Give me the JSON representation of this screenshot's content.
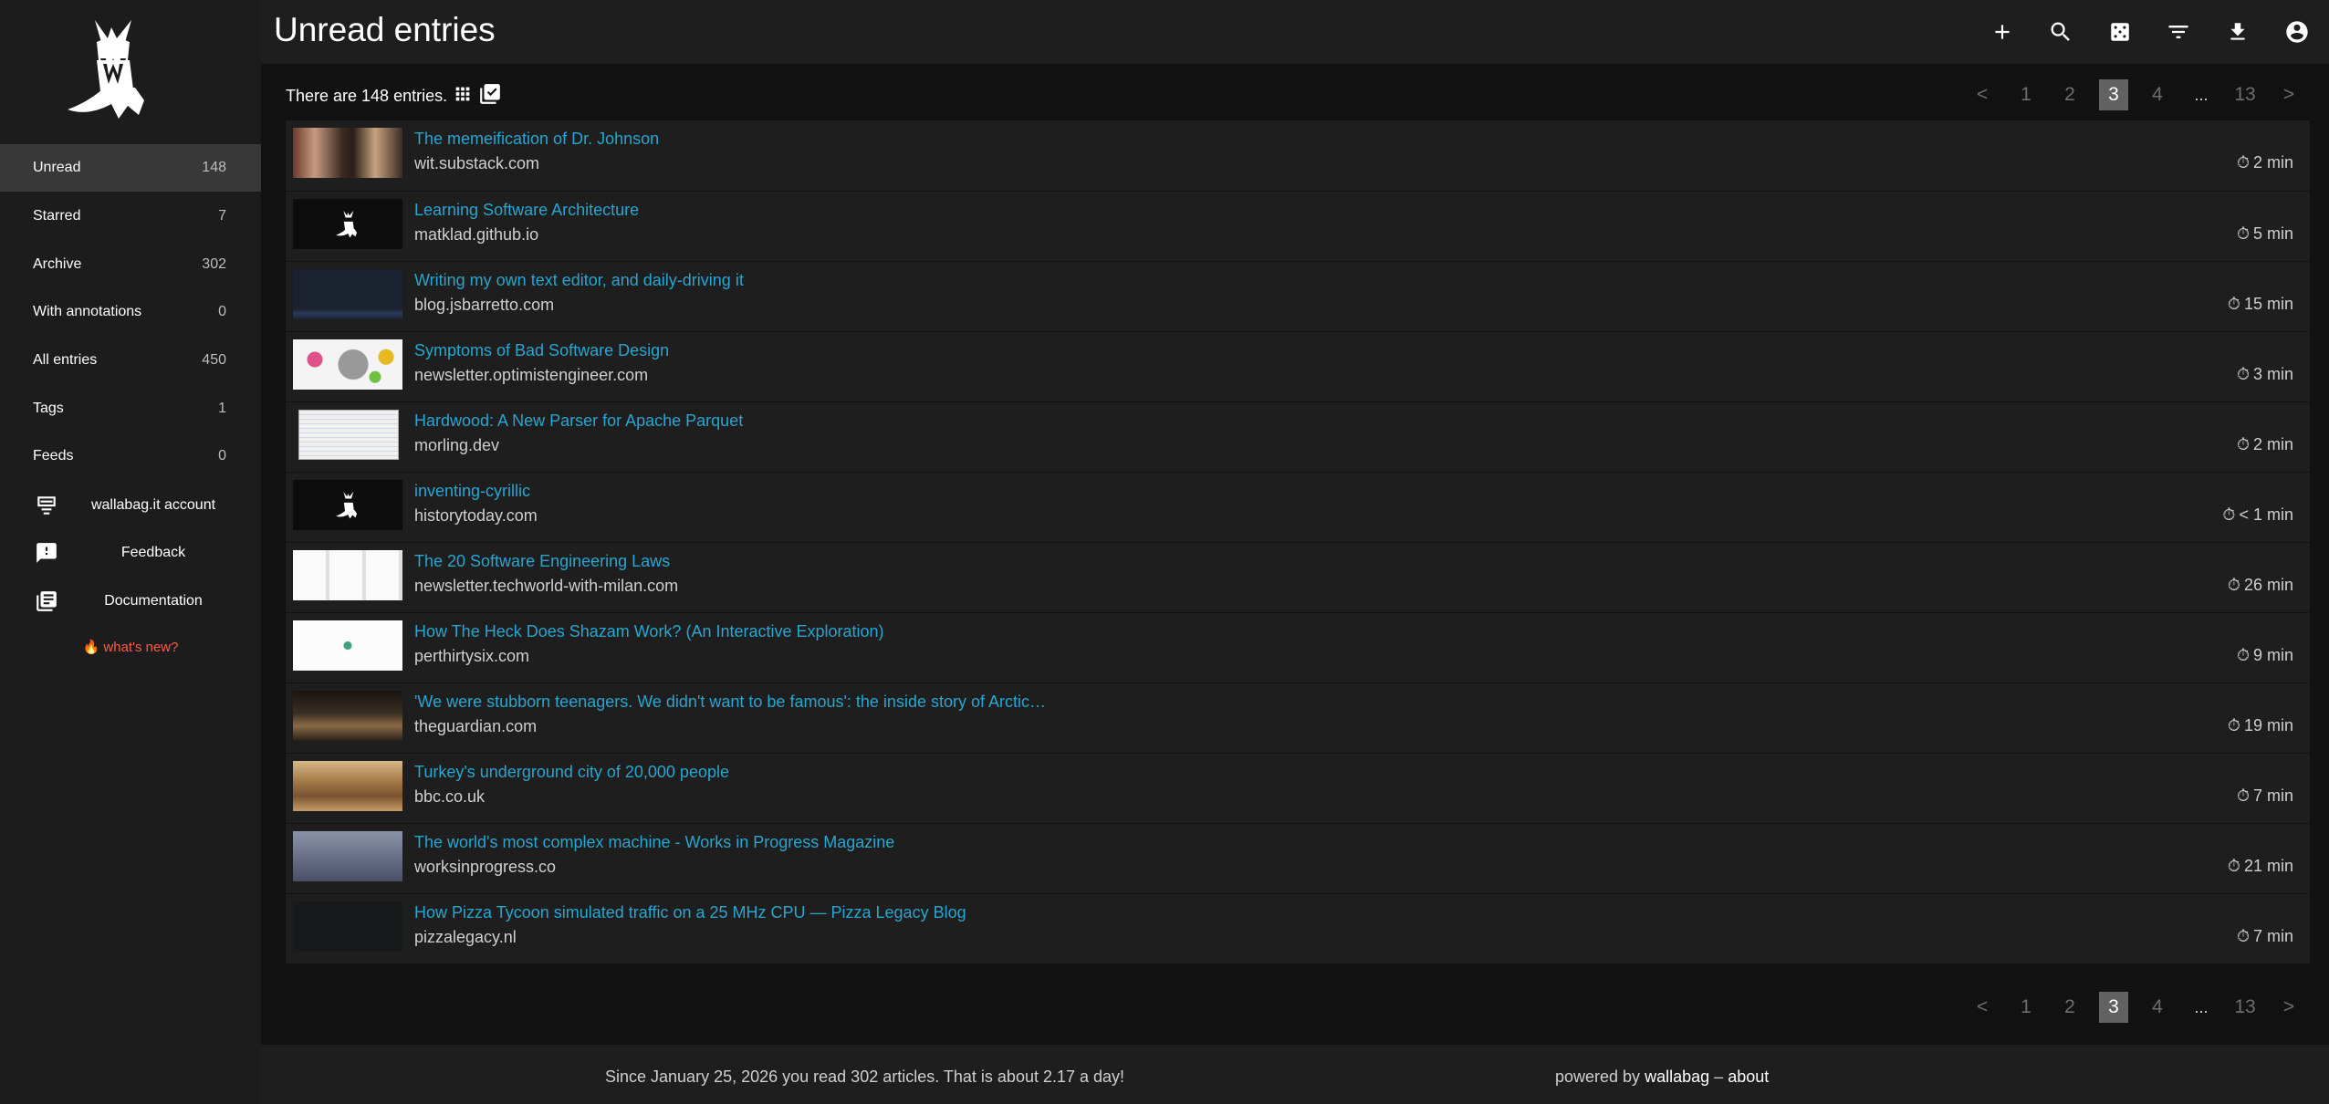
{
  "header": {
    "title": "Unread entries",
    "icons": [
      "add-icon",
      "search-icon",
      "random-icon",
      "filter-icon",
      "export-icon",
      "account-icon"
    ]
  },
  "sidebar": {
    "items": [
      {
        "label": "Unread",
        "count": "148"
      },
      {
        "label": "Starred",
        "count": "7"
      },
      {
        "label": "Archive",
        "count": "302"
      },
      {
        "label": "With annotations",
        "count": "0"
      },
      {
        "label": "All entries",
        "count": "450"
      },
      {
        "label": "Tags",
        "count": "1"
      },
      {
        "label": "Feeds",
        "count": "0"
      }
    ],
    "external": [
      {
        "label": "wallabag.it account",
        "icon": "account-card-icon"
      },
      {
        "label": "Feedback",
        "icon": "feedback-icon"
      },
      {
        "label": "Documentation",
        "icon": "documentation-icon"
      }
    ],
    "whats_new": "what's new?"
  },
  "main": {
    "entries_info": "There are 148 entries.",
    "pagination": {
      "prev": "<",
      "pages": [
        "1",
        "2",
        "3",
        "4",
        "...",
        "13"
      ],
      "active_page": "3",
      "next": ">"
    },
    "entries": [
      {
        "title": "The memeification of Dr. Johnson",
        "domain": "wit.substack.com",
        "reading_time": "2 min"
      },
      {
        "title": "Learning Software Architecture",
        "domain": "matklad.github.io",
        "reading_time": "5 min"
      },
      {
        "title": "Writing my own text editor, and daily-driving it",
        "domain": "blog.jsbarretto.com",
        "reading_time": "15 min"
      },
      {
        "title": "Symptoms of Bad Software Design",
        "domain": "newsletter.optimistengineer.com",
        "reading_time": "3 min"
      },
      {
        "title": "Hardwood: A New Parser for Apache Parquet",
        "domain": "morling.dev",
        "reading_time": "2 min"
      },
      {
        "title": "inventing-cyrillic",
        "domain": "historytoday.com",
        "reading_time": "< 1 min"
      },
      {
        "title": "The 20 Software Engineering Laws",
        "domain": "newsletter.techworld-with-milan.com",
        "reading_time": "26 min"
      },
      {
        "title": "How The Heck Does Shazam Work? (An Interactive Exploration)",
        "domain": "perthirtysix.com",
        "reading_time": "9 min"
      },
      {
        "title": "'We were stubborn teenagers. We didn't want to be famous': the inside story of Arctic…",
        "domain": "theguardian.com",
        "reading_time": "19 min"
      },
      {
        "title": "Turkey's underground city of 20,000 people",
        "domain": "bbc.co.uk",
        "reading_time": "7 min"
      },
      {
        "title": "The world's most complex machine - Works in Progress Magazine",
        "domain": "worksinprogress.co",
        "reading_time": "21 min"
      },
      {
        "title": "How Pizza Tycoon simulated traffic on a 25 MHz CPU — Pizza Legacy Blog",
        "domain": "pizzalegacy.nl",
        "reading_time": "7 min"
      }
    ]
  },
  "footer": {
    "stats": "Since January 25, 2026 you read 302 articles. That is about 2.17 a day!",
    "powered_prefix": "powered by",
    "powered_link": "wallabag",
    "separator": "–",
    "about": "about"
  },
  "colors": {
    "link": "#26a6d1",
    "whats_new": "#ff5a4a",
    "sidebar_bg": "#1c1c1c",
    "active_bg": "#383838"
  }
}
